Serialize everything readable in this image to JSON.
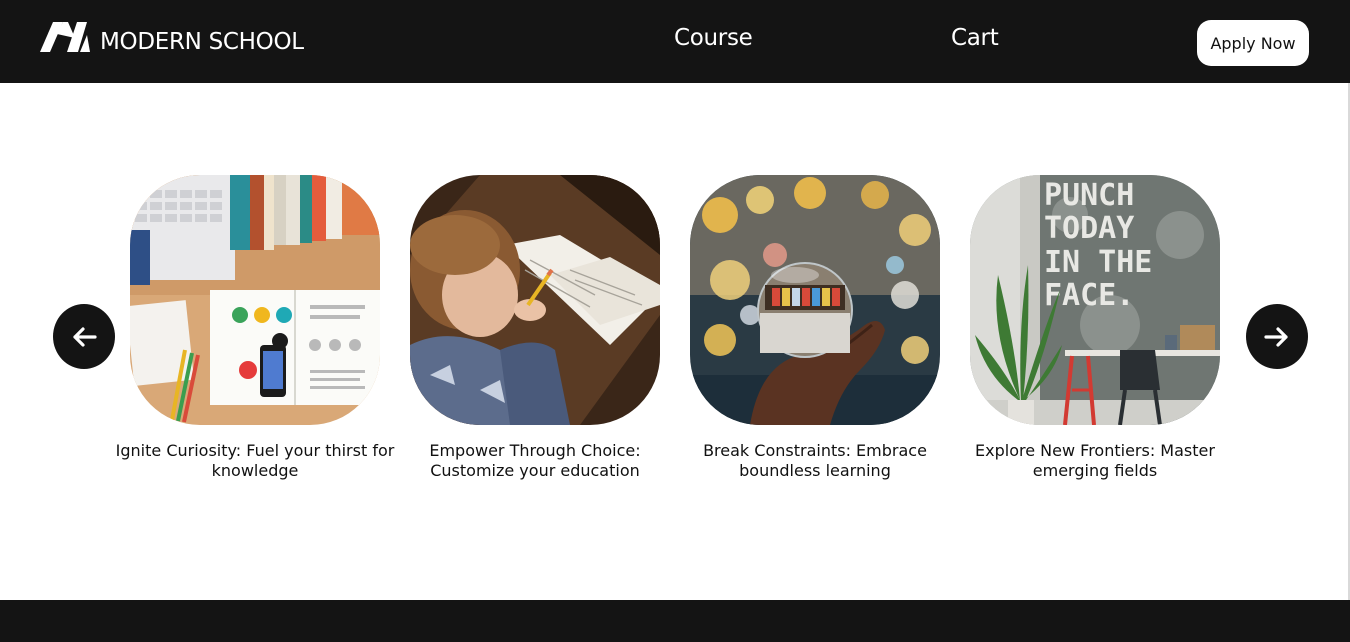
{
  "header": {
    "brand_name": "MODERN SCHOOL",
    "nav": [
      {
        "label": "Course"
      },
      {
        "label": "Cart"
      }
    ],
    "cta_label": "Apply Now"
  },
  "carousel": {
    "prev_icon": "arrow-left-icon",
    "next_icon": "arrow-right-icon",
    "cards": [
      {
        "caption": "Ignite Curiosity: Fuel your thirst for knowledge",
        "image": "desk-books-laptop"
      },
      {
        "caption": "Empower Through Choice: Customize your education",
        "image": "child-writing"
      },
      {
        "caption": "Break Constraints: Embrace boundless learning",
        "image": "hand-crystal-ball-bokeh"
      },
      {
        "caption": "Explore New Frontiers: Master emerging fields",
        "image": "punch-today-wall"
      }
    ],
    "wall_text": [
      "PUNCH",
      "TODAY",
      "IN THE",
      "FACE."
    ]
  },
  "colors": {
    "dark": "#141414",
    "light": "#ffffff"
  }
}
